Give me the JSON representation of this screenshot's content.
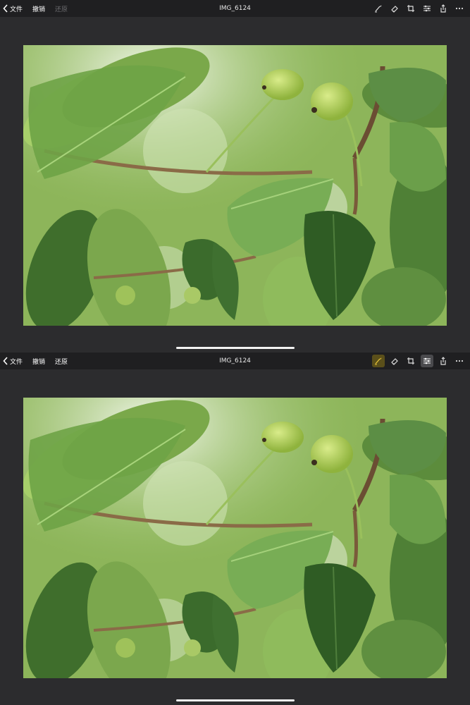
{
  "panels": [
    {
      "toolbar": {
        "back_label": "文件",
        "undo_label": "撤销",
        "redo_label": "还原",
        "title": "IMG_6124"
      }
    },
    {
      "toolbar": {
        "back_label": "文件",
        "undo_label": "撤销",
        "redo_label": "还原",
        "title": "IMG_6124"
      }
    }
  ],
  "icons": [
    "brush-icon",
    "eraser-icon",
    "crop-icon",
    "adjust-sliders-icon",
    "share-icon",
    "more-icon"
  ],
  "colors": {
    "toolbar_bg": "#1f1f21",
    "canvas_bg": "#2c2c2e",
    "active_accent": "#e6c23a"
  }
}
